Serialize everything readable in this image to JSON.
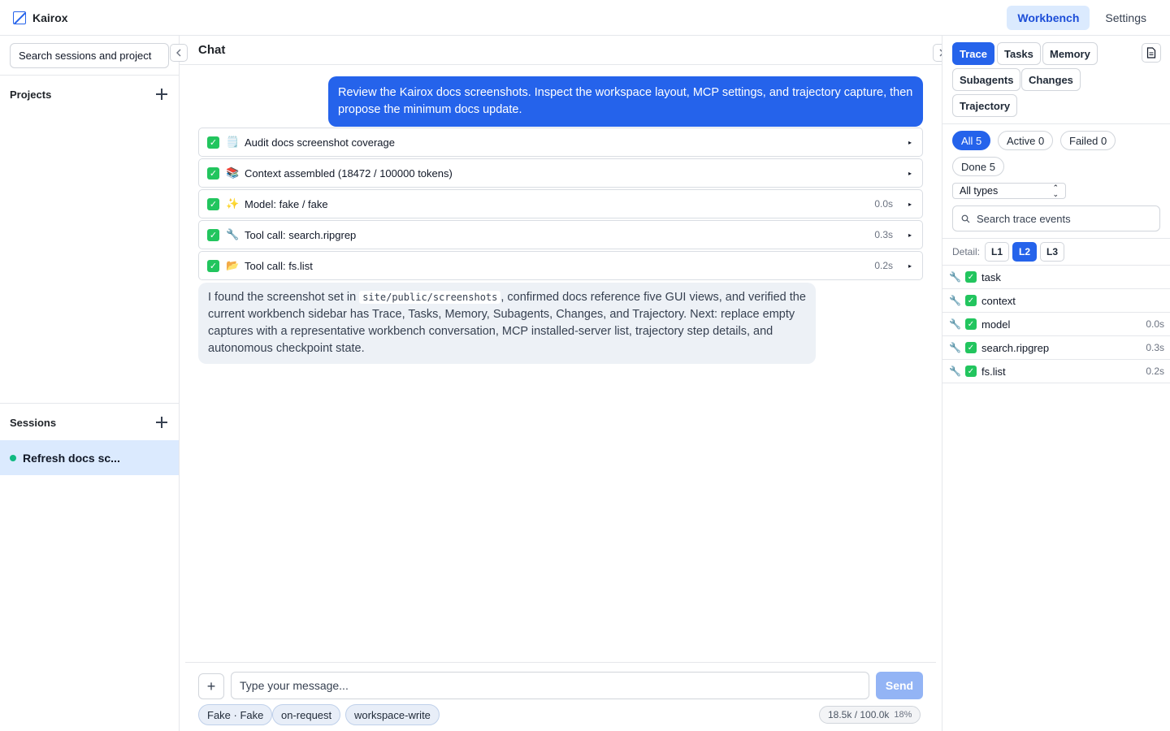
{
  "app": {
    "name": "Kairox"
  },
  "top_nav": {
    "workbench": "Workbench",
    "settings": "Settings"
  },
  "sidebar": {
    "search_value": "Search sessions and project",
    "projects_title": "Projects",
    "sessions_title": "Sessions",
    "sessions": [
      {
        "label": "Refresh docs sc...",
        "status_color": "#10b981"
      }
    ]
  },
  "chat": {
    "title": "Chat",
    "user_message": "Review the Kairox docs screenshots. Inspect the workspace layout, MCP settings, and trajectory capture, then propose the minimum docs update.",
    "steps": [
      {
        "icon": "🗒️",
        "label": "Audit docs screenshot coverage",
        "time": ""
      },
      {
        "icon": "📚",
        "label": "Context assembled (18472 / 100000 tokens)",
        "time": ""
      },
      {
        "icon": "✨",
        "label": "Model: fake / fake",
        "time": "0.0s"
      },
      {
        "icon": "🔧",
        "label": "Tool call: search.ripgrep",
        "time": "0.3s"
      },
      {
        "icon": "📂",
        "label": "Tool call: fs.list",
        "time": "0.2s"
      }
    ],
    "assistant_before": "I found the screenshot set in ",
    "assistant_code": "site/public/screenshots",
    "assistant_after": ", confirmed docs reference five GUI views, and verified the current workbench sidebar has Trace, Tasks, Memory, Subagents, Changes, and Trajectory. Next: replace empty captures with a representative workbench conversation, MCP installed-server list, trajectory step details, and autonomous checkpoint state."
  },
  "composer": {
    "placeholder": "Type your message...",
    "send_label": "Send",
    "chips": [
      "Fake · Fake",
      "on-request",
      "workspace-write"
    ],
    "token_usage": "18.5k / 100.0k",
    "token_percent": "18%"
  },
  "right_panel": {
    "tabs": [
      "Trace",
      "Tasks",
      "Memory",
      "Subagents",
      "Changes",
      "Trajectory"
    ],
    "filters": [
      "All 5",
      "Active 0",
      "Failed 0",
      "Done 5"
    ],
    "type_select": "All types",
    "search_placeholder": "Search trace events",
    "detail_label": "Detail:",
    "levels": [
      "L1",
      "L2",
      "L3"
    ],
    "events": [
      {
        "name": "task",
        "time": ""
      },
      {
        "name": "context",
        "time": ""
      },
      {
        "name": "model",
        "time": "0.0s"
      },
      {
        "name": "search.ripgrep",
        "time": "0.3s"
      },
      {
        "name": "fs.list",
        "time": "0.2s"
      }
    ]
  },
  "colors": {
    "accent": "#2563eb",
    "success": "#22c55e",
    "active_bg": "#dbeafe"
  }
}
